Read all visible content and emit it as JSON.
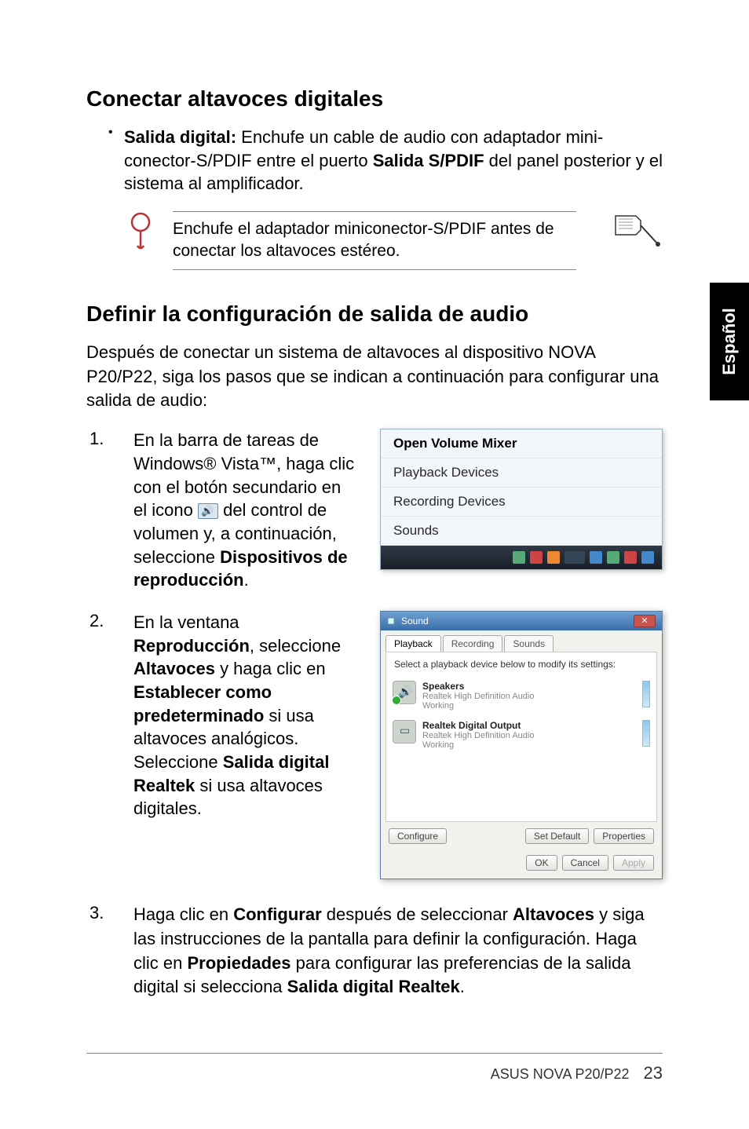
{
  "side_tab": "Español",
  "section1": {
    "title": "Conectar altavoces digitales",
    "bullet_label_bold": "Salida digital:",
    "bullet_text_rest": " Enchufe un cable de audio con adaptador mini­conector-S/PDIF entre el puerto ",
    "bullet_bold_mid": "Salida S/PDIF",
    "bullet_text_tail": " del panel posterior y el sistema al amplificador.",
    "note": "Enchufe el adaptador miniconector-S/PDIF antes de conectar los altavoces estéreo."
  },
  "section2": {
    "title": "Definir la configuración de salida de audio",
    "intro": "Después de conectar un sistema de altavoces al dispositivo NOVA P20/P22, siga los pasos que se indican a continuación para configurar una salida de audio:",
    "steps": {
      "s1": {
        "num": "1.",
        "pre": "En la barra de tareas de Windows® Vista™, haga clic con el botón secundario en el icono ",
        "mid": " del control de volumen y, a continuación, seleccione ",
        "bold": "Dispositivos de reproducción",
        "tail": "."
      },
      "s2": {
        "num": "2.",
        "t1": "En la ventana ",
        "b1": "Reproducción",
        "t2": ", seleccione ",
        "b2": "Altavoces",
        "t3": " y haga clic en ",
        "b3": "Establecer como predeterminado",
        "t4": " si usa altavoces analógicos. Seleccione ",
        "b4": "Salida digital Realtek",
        "t5": " si usa altavoces digitales."
      },
      "s3": {
        "num": "3.",
        "t1": "Haga clic en ",
        "b1": "Configurar",
        "t2": " después de seleccionar ",
        "b2": "Altavoces",
        "t3": " y siga las instrucciones de la pantalla para definir la configuración. Haga clic en ",
        "b3": "Propiedades",
        "t4": " para configurar las preferencias de la salida digital si selecciona ",
        "b4": "Salida digital Realtek",
        "t5": "."
      }
    }
  },
  "context_menu": {
    "items": [
      {
        "label": "Open Volume Mixer",
        "bold": true
      },
      {
        "label": "Playback Devices",
        "bold": false
      },
      {
        "label": "Recording Devices",
        "bold": false
      },
      {
        "label": "Sounds",
        "bold": false
      }
    ]
  },
  "sound_dialog": {
    "title": "Sound",
    "tabs": [
      "Playback",
      "Recording",
      "Sounds"
    ],
    "instruction": "Select a playback device below to modify its settings:",
    "devices": [
      {
        "name": "Speakers",
        "sub1": "Realtek High Definition Audio",
        "sub2": "Working",
        "kind": "spk",
        "check": true
      },
      {
        "name": "Realtek Digital Output",
        "sub1": "Realtek High Definition Audio",
        "sub2": "Working",
        "kind": "dig",
        "check": false
      }
    ],
    "buttons": {
      "configure": "Configure",
      "set_default": "Set Default",
      "properties": "Properties",
      "ok": "OK",
      "cancel": "Cancel",
      "apply": "Apply"
    }
  },
  "footer": {
    "product": "ASUS NOVA P20/P22",
    "page": "23"
  }
}
